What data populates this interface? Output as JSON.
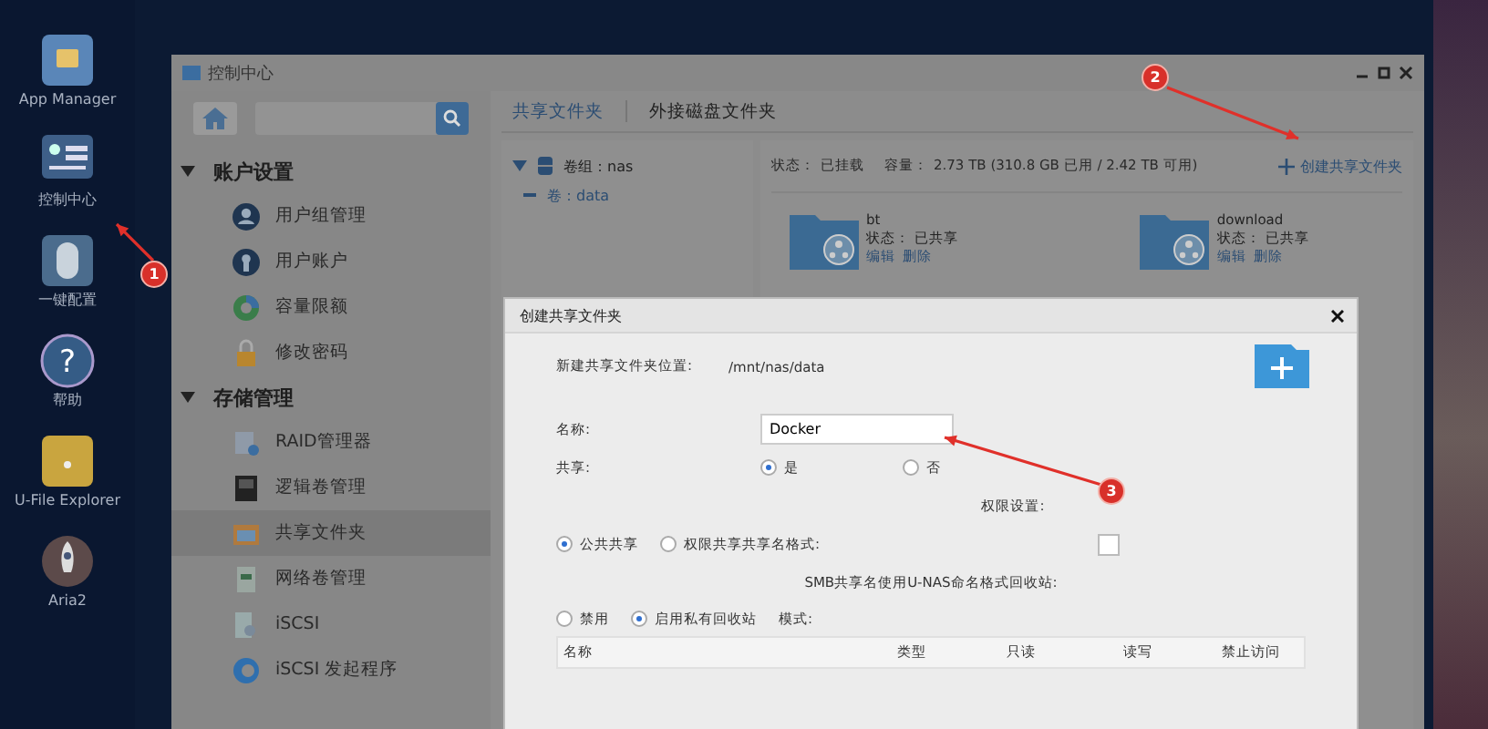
{
  "dock": [
    {
      "label": "App Manager",
      "kind": "app"
    },
    {
      "label": "控制中心",
      "kind": "control"
    },
    {
      "label": "一键配置",
      "kind": "mouse"
    },
    {
      "label": "帮助",
      "kind": "help",
      "glyph": "?"
    },
    {
      "label": "U-File Explorer",
      "kind": "files"
    },
    {
      "label": "Aria2",
      "kind": "rocket"
    }
  ],
  "window": {
    "title": "控制中心"
  },
  "sidebar": [
    {
      "label": "账户设置",
      "expanded": true,
      "children": [
        {
          "label": "用户组管理",
          "kind": "group",
          "selected": false
        },
        {
          "label": "用户账户",
          "kind": "user",
          "selected": false
        },
        {
          "label": "容量限额",
          "kind": "pie",
          "selected": false
        },
        {
          "label": "修改密码",
          "kind": "lock",
          "selected": false
        }
      ]
    },
    {
      "label": "存储管理",
      "expanded": true,
      "children": [
        {
          "label": "RAID管理器",
          "kind": "raid",
          "selected": false
        },
        {
          "label": "逻辑卷管理",
          "kind": "volume",
          "selected": false
        },
        {
          "label": "共享文件夹",
          "kind": "share",
          "selected": true
        },
        {
          "label": "网络卷管理",
          "kind": "network",
          "selected": false
        },
        {
          "label": "iSCSI",
          "kind": "disk",
          "selected": false
        },
        {
          "label": "iSCSI 发起程序",
          "kind": "globe",
          "selected": false
        }
      ]
    }
  ],
  "tabs": [
    {
      "label": "共享文件夹",
      "selected": true
    },
    {
      "label": "外接磁盘文件夹",
      "selected": false
    }
  ],
  "tree": {
    "label": "卷组：nas",
    "expanded": true,
    "children": [
      {
        "label": "卷：data"
      }
    ]
  },
  "status_line": {
    "status_label": "状态：",
    "status": "已挂载",
    "capacity_label": "容量：",
    "capacity": "2.73 TB (310.8 GB 已用 / 2.42 TB 可用)",
    "create_button": "创建共享文件夹"
  },
  "folders": [
    {
      "name": "bt",
      "status": "状态：  已共享",
      "actions": [
        "编辑",
        "删除"
      ]
    },
    {
      "name": "download",
      "status": "状态：  已共享",
      "actions": [
        "编辑",
        "删除"
      ]
    }
  ],
  "dialog": {
    "title": "创建共享文件夹",
    "location_label": "新建共享文件夹位置:",
    "location": "/mnt/nas/data",
    "name_label": "名称:",
    "name_value": "Docker",
    "share_label": "共享:",
    "share_options": [
      {
        "label": "是",
        "selected": true
      },
      {
        "label": "否",
        "selected": false
      }
    ],
    "permission_label": "权限设置:",
    "access_options": [
      {
        "label": "公共共享",
        "selected": true
      },
      {
        "label": "权限共享共享名格式:",
        "selected": false
      }
    ],
    "smb_checkbox": {
      "checked": false
    },
    "smb_label": "SMB共享名使用U-NAS命名格式回收站:",
    "recycle_options": [
      {
        "label": "禁用",
        "selected": false
      },
      {
        "label": "启用私有回收站",
        "selected": true
      }
    ],
    "mode_label": "模式:",
    "columns": [
      "名称",
      "类型",
      "只读",
      "读写",
      "禁止访问"
    ]
  },
  "annotations": [
    {
      "label": "1"
    },
    {
      "label": "2"
    },
    {
      "label": "3"
    }
  ]
}
